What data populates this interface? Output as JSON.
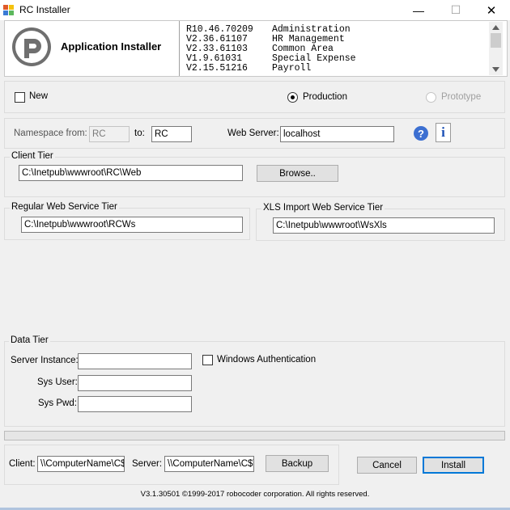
{
  "window": {
    "title": "RC Installer",
    "minimize": "—",
    "maximize": "☐",
    "close": "✕"
  },
  "header": {
    "title": "Application Installer",
    "modules": [
      {
        "version": "R10.46.70209",
        "name": "Administration"
      },
      {
        "version": "V2.36.61107",
        "name": "HR Management"
      },
      {
        "version": "V2.33.61103",
        "name": "Common Area"
      },
      {
        "version": "V1.9.61031",
        "name": "Special Expense"
      },
      {
        "version": "V2.15.51216",
        "name": "Payroll"
      }
    ]
  },
  "mode": {
    "new_label": "New",
    "production_label": "Production",
    "prototype_label": "Prototype",
    "selected": "Production"
  },
  "namespace": {
    "from_label": "Namespace from:",
    "from_value": "RC",
    "to_label": "to:",
    "to_value": "RC",
    "webserver_label": "Web Server:",
    "webserver_value": "localhost",
    "help_icon": "?",
    "info_icon": "i"
  },
  "client_tier": {
    "title": "Client Tier",
    "path": "C:\\Inetpub\\wwwroot\\RC\\Web",
    "browse_label": "Browse.."
  },
  "regular_ws_tier": {
    "title": "Regular Web Service Tier",
    "path": "C:\\Inetpub\\wwwroot\\RCWs"
  },
  "xls_ws_tier": {
    "title": "XLS Import Web Service Tier",
    "path": "C:\\Inetpub\\wwwroot\\WsXls"
  },
  "data_tier": {
    "title": "Data Tier",
    "server_instance_label": "Server Instance:",
    "server_instance_value": "",
    "windows_auth_label": "Windows Authentication",
    "sys_user_label": "Sys User:",
    "sys_user_value": "",
    "sys_pwd_label": "Sys Pwd:",
    "sys_pwd_value": ""
  },
  "backup": {
    "client_label": "Client:",
    "client_value": "\\\\ComputerName\\C$",
    "server_label": "Server:",
    "server_value": "\\\\ComputerName\\C$\\",
    "backup_label": "Backup"
  },
  "actions": {
    "cancel_label": "Cancel",
    "install_label": "Install"
  },
  "footer": {
    "text": "V3.1.30501 ©1999-2017 robocoder corporation. All rights reserved."
  },
  "colors": {
    "accent": "#0078d7",
    "help_blue": "#3c6fd1",
    "info_blue": "#1a4fb5"
  }
}
